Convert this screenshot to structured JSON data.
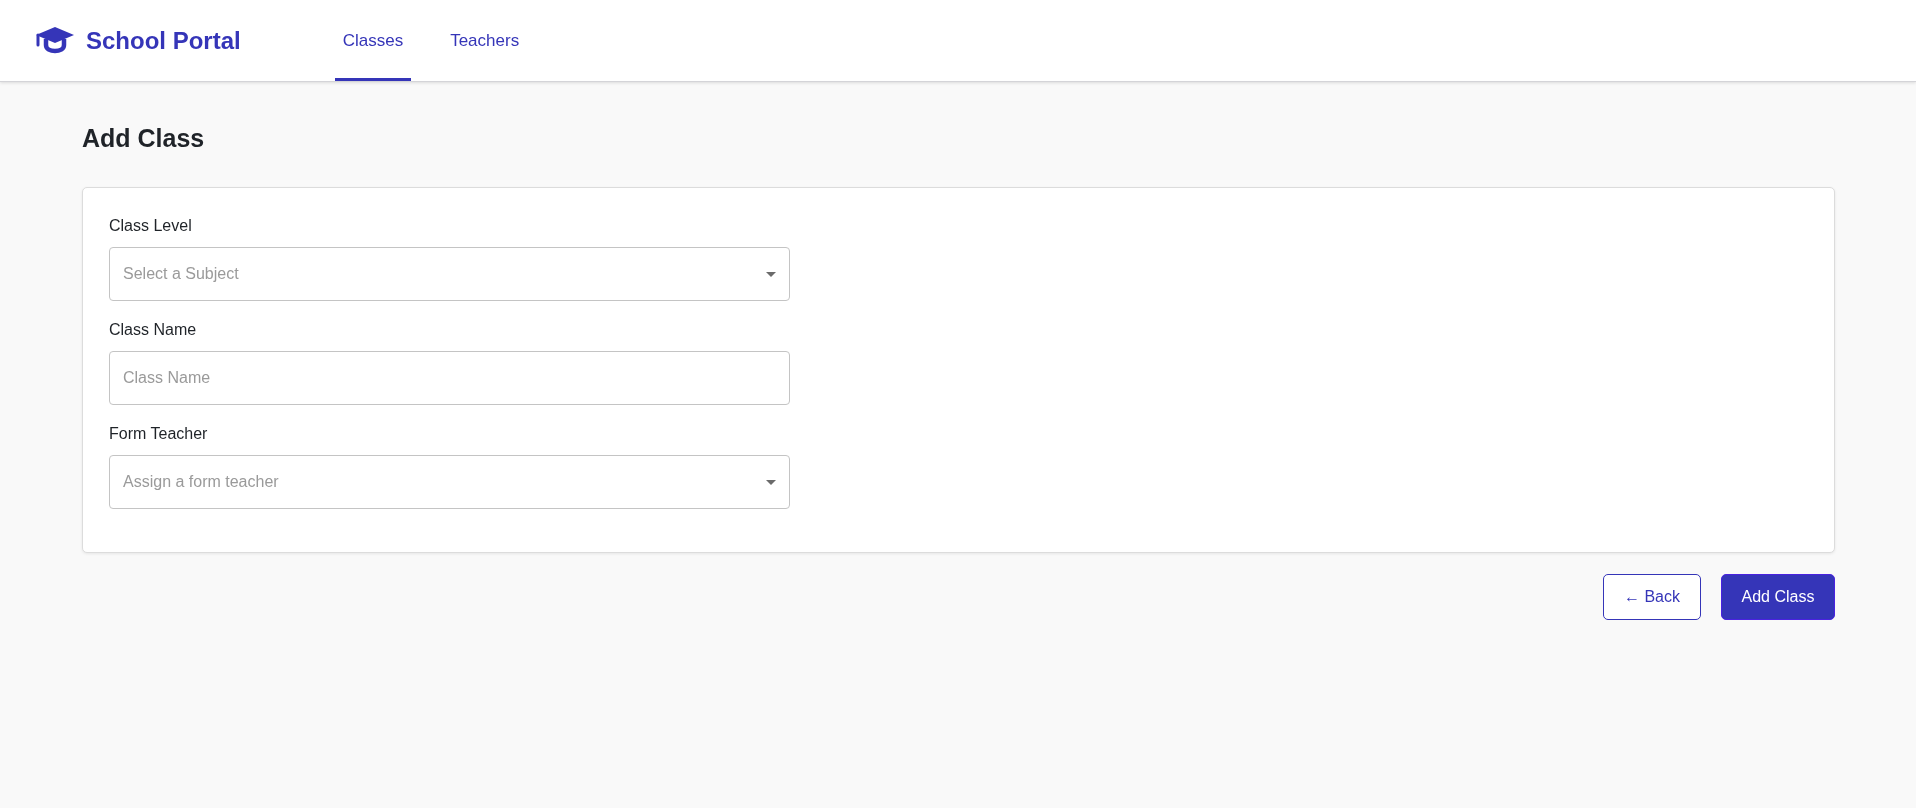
{
  "header": {
    "logo": {
      "text": "School Portal"
    },
    "tabs": [
      {
        "label": "Classes",
        "selected": true
      },
      {
        "label": "Teachers",
        "selected": false
      }
    ]
  },
  "page": {
    "title": "Add Class"
  },
  "form": {
    "fields": [
      {
        "label": "Class Level",
        "kind": "select",
        "placeholder": "Select a Subject"
      },
      {
        "label": "Class Name",
        "kind": "text",
        "placeholder": "Class Name"
      },
      {
        "label": "Form Teacher",
        "kind": "select",
        "placeholder": "Assign a form teacher"
      }
    ]
  },
  "actions": [
    {
      "label": "← Back",
      "kind": "secondary"
    },
    {
      "label": "Add Class",
      "kind": "primary"
    }
  ]
}
